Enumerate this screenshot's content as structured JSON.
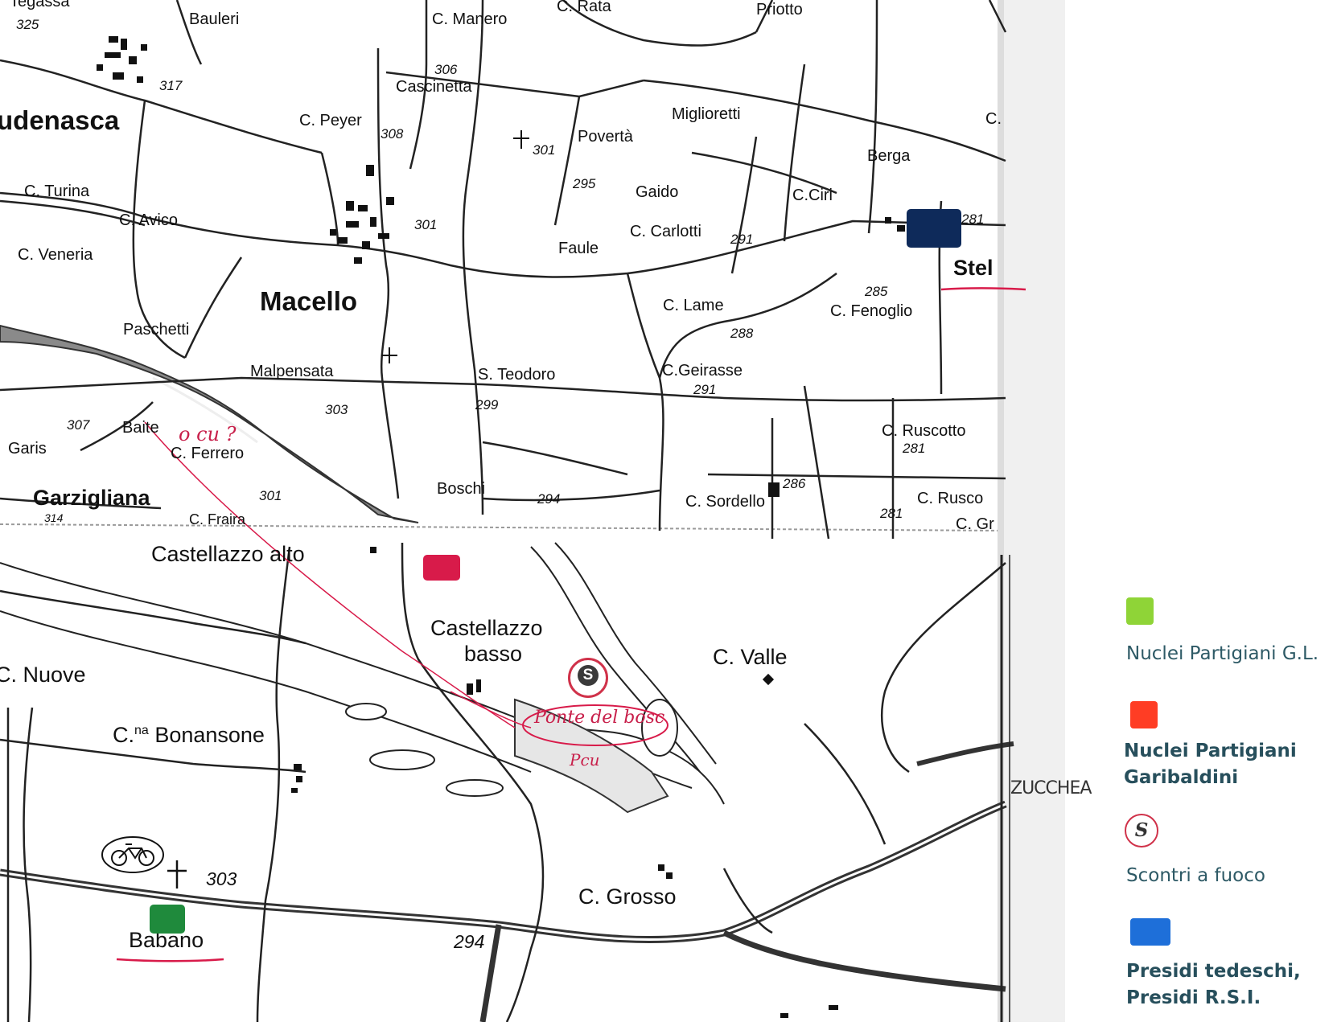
{
  "map": {
    "top_labels": {
      "tegassa": "Tegassa",
      "elev_325": "325",
      "bauleri": "Bauleri",
      "manero": "C. Manero",
      "rata": "C. Rata",
      "priotto": "Priotto",
      "elev_317": "317",
      "elev_306": "306",
      "cascinetta": "Cascinetta",
      "udenasca": "udenasca",
      "peyer": "C. Peyer",
      "elev_308": "308",
      "miglioretti": "Miglioretti",
      "poverta": "Povertà",
      "elev_301a": "301",
      "c_edge": "C.",
      "berga": "Berga",
      "turina": "C. Turina",
      "elev_295": "295",
      "gaido": "Gaido",
      "c_ciri": "C.Ciri",
      "avico": "C. Avico",
      "elev_301b": "301",
      "c_carlotti": "C. Carlotti",
      "elev_291a": "291",
      "elev_281a": "281",
      "veneria": "C. Veneria",
      "faule": "Faule",
      "stel": "Stel",
      "elev_285": "285",
      "macello": "Macello",
      "c_lame": "C. Lame",
      "fenoglio": "C. Fenoglio",
      "paschetti": "Paschetti",
      "elev_288": "288",
      "malpensata": "Malpensata",
      "s_teodoro": "S. Teodoro",
      "c_geirasse": "C.Geirasse",
      "elev_291b": "291",
      "elev_303a": "303",
      "elev_299": "299",
      "elev_307": "307",
      "baite": "Baite",
      "c_ruscotto": "C. Ruscotto",
      "elev_281b": "281",
      "garis": "Garis",
      "c_ferrero": "C. Ferrero",
      "elev_286": "286",
      "garzigliana": "Garzigliana",
      "elev_301c": "301",
      "boschi": "Boschi",
      "elev_294a": "294",
      "c_sordello": "C. Sordello",
      "c_rusco": "C. Rusco",
      "elev_281c": "281",
      "elev_314": "314",
      "c_fraira": "C. Fraira",
      "c_gr": "C. Gr"
    },
    "bottom_labels": {
      "castellazzo_alto": "Castellazzo alto",
      "castellazzo_basso_1": "Castellazzo",
      "castellazzo_basso_2": "basso",
      "c_valle": "C. Valle",
      "c_nuove": "C. Nuove",
      "bonansone_prefix": "C.",
      "bonansone_sup": "na",
      "bonansone": "Bonansone",
      "c_grosso": "C. Grosso",
      "elev_303b": "303",
      "babano": "Babano",
      "elev_294b": "294"
    },
    "handwritten": {
      "ponte": "Ponte del bosc",
      "ponte_sub": "Pcu",
      "question": "o cu ?",
      "zucchea": "ZUCCHEA"
    },
    "scontro_marker": "S"
  },
  "legend": {
    "items": [
      {
        "label": "Nuclei Partigiani G.L.",
        "color": "#8fd437"
      },
      {
        "label_1": "Nuclei Partigiani",
        "label_2": "Garibaldini",
        "color": "#ff3d24"
      },
      {
        "label": "Scontri a fuoco",
        "symbol": "S"
      },
      {
        "label_1": "Presidi tedeschi,",
        "label_2": "Presidi R.S.I.",
        "color": "#1e6fd9"
      }
    ]
  },
  "markers": {
    "green": "#1f8a3c",
    "red": "#d81b4a",
    "navy": "#0e2a5a"
  }
}
